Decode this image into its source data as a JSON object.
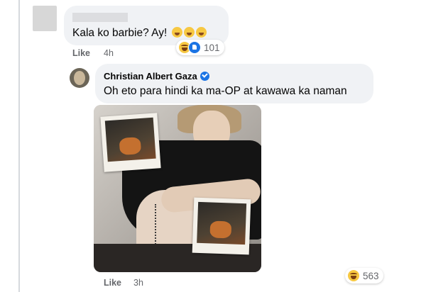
{
  "comment1": {
    "text": "Kala ko barbie? Ay!",
    "text_emojis": [
      "laughing-emoji",
      "laughing-emoji",
      "laughing-emoji"
    ],
    "reactions": {
      "icons": [
        "haha",
        "like"
      ],
      "count": "101"
    },
    "actions": {
      "like_label": "Like",
      "time": "4h"
    }
  },
  "comment2": {
    "author": "Christian Albert Gaza",
    "verified": true,
    "text": "Oh eto para hindi ka ma-OP at kawawa ka naman",
    "reactions": {
      "icons": [
        "haha"
      ],
      "count": "563"
    },
    "actions": {
      "like_label": "Like",
      "time": "3h"
    }
  },
  "colors": {
    "bubble_bg": "#f0f2f5",
    "meta_text": "#65676b",
    "verified_blue": "#1b74e4",
    "haha_yellow": "#f7c842"
  }
}
